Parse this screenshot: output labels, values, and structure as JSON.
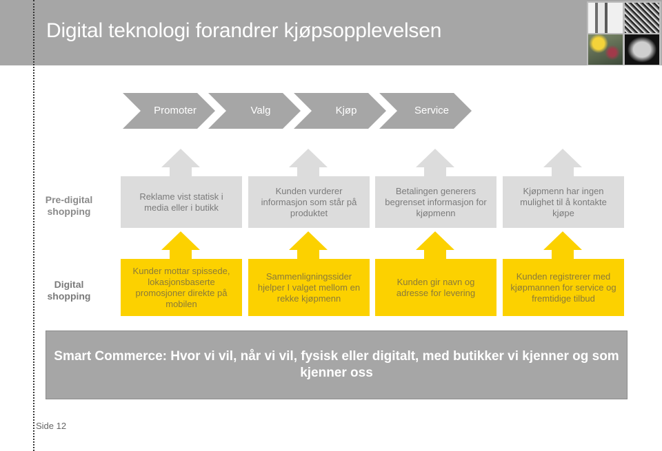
{
  "slide": {
    "title": "Digital teknologi forandrer kjøpsopplevelsen",
    "page_label": "Side 12"
  },
  "colors": {
    "header_bg": "#a6a6a6",
    "chevron": "#a6a6a6",
    "grey_box": "#dcdcdc",
    "yellow_box": "#fcd100",
    "banner_bg": "#a6a6a6"
  },
  "header_images": [
    {
      "icon": "architecture-columns-photo"
    },
    {
      "icon": "abstract-texture-photo"
    },
    {
      "icon": "cyclists-photo"
    },
    {
      "icon": "tunnel-grid-photo"
    }
  ],
  "stages": [
    "Promoter",
    "Valg",
    "Kjøp",
    "Service"
  ],
  "rows": [
    {
      "label": "Pre-digital shopping",
      "items": [
        "Reklame vist statisk i media eller i butikk",
        "Kunden vurderer informasjon som står på produktet",
        "Betalingen generers begrenset informasjon for kjøpmenn",
        "Kjøpmenn har ingen mulighet til å kontakte kjøpe"
      ]
    },
    {
      "label": "Digital shopping",
      "items": [
        "Kunder mottar spissede, lokasjonsbaserte promosjoner direkte på mobilen",
        "Sammenligningssider hjelper I valget mellom en rekke kjøpmenn",
        "Kunden gir navn og adresse for levering",
        "Kunden registrerer med kjøpmannen for service og fremtidige tilbud"
      ]
    }
  ],
  "banner": {
    "text": "Smart Commerce: Hvor vi vil, når vi vil, fysisk eller digitalt, med butikker vi kjenner og som kjenner oss"
  }
}
